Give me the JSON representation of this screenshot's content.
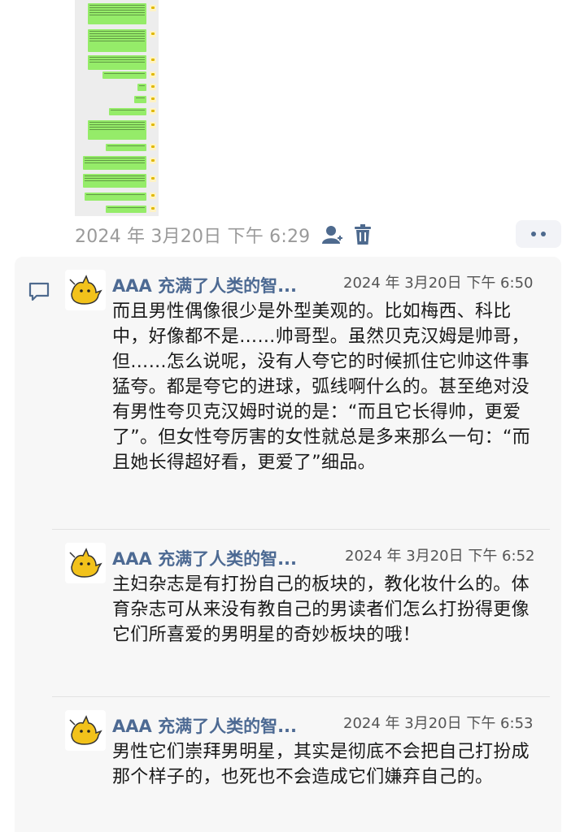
{
  "post": {
    "timestamp": "2024 年 3月20日 下午 6:29",
    "icons": [
      "user-icon",
      "trash-icon"
    ],
    "more_icon": "more-dots-icon"
  },
  "comments": [
    {
      "author": "AAA 充满了人类的智...",
      "time": "2024 年 3月20日 下午 6:50",
      "text": "而且男性偶像很少是外型美观的。比如梅西、科比中，好像都不是……帅哥型。虽然贝克汉姆是帅哥，但……怎么说呢，没有人夸它的时候抓住它帅这件事猛夸。都是夸它的进球，弧线啊什么的。甚至绝对没有男性夸贝克汉姆时说的是：“而且它长得帅，更爱了”。但女性夸厉害的女性就总是多来那么一句：“而且她长得超好看，更爱了”细品。"
    },
    {
      "author": "AAA 充满了人类的智...",
      "time": "2024 年 3月20日 下午 6:52",
      "text": "主妇杂志是有打扮自己的板块的，教化妆什么的。体育杂志可从来没有教自己的男读者们怎么打扮得更像它们所喜爱的男明星的奇妙板块的哦！"
    },
    {
      "author": "AAA 充满了人类的智...",
      "time": "2024 年 3月20日 下午 6:53",
      "text": "男性它们崇拜男明星，其实是彻底不会把自己打扮成那个样子的，也死也不会造成它们嫌弃自己的。"
    }
  ],
  "colors": {
    "name": "#4d6a93",
    "bubble": "#95ec69",
    "card": "#f7f7f7"
  }
}
